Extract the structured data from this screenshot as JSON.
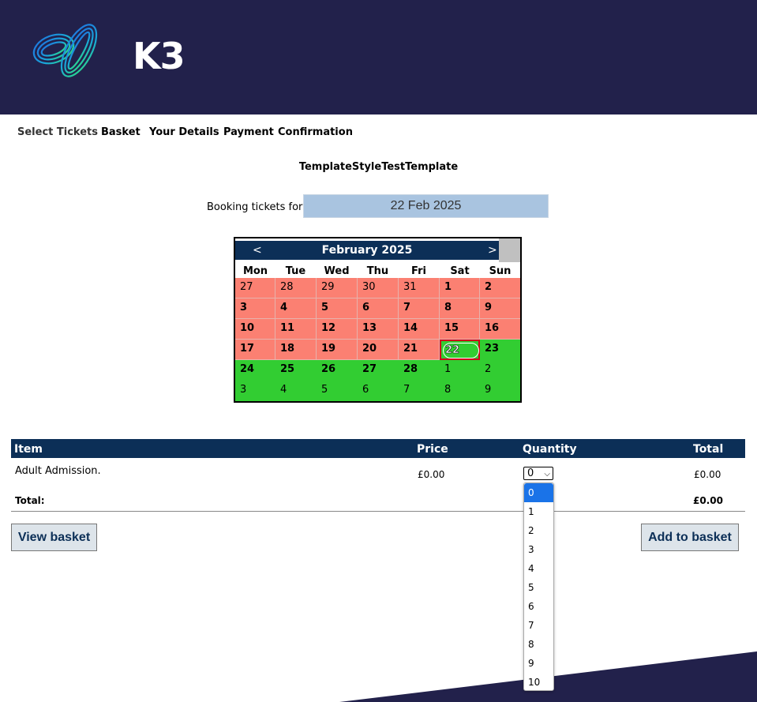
{
  "header": {
    "logo_text": "K3",
    "colors": {
      "background": "#22214b",
      "logo_blue": "#1f7ae0",
      "logo_green": "#2ecc71"
    }
  },
  "nav": {
    "items": [
      "Select Tickets",
      "Basket",
      "Your Details",
      "Payment",
      "Confirmation"
    ],
    "active": "Select Tickets"
  },
  "page_title": "TemplateStyleTestTemplate",
  "booking": {
    "label": "Booking tickets for:",
    "value": "22 Feb 2025"
  },
  "calendar": {
    "month_label": "February 2025",
    "prev_label": "<",
    "next_label": ">",
    "weekdays": [
      "Mon",
      "Tue",
      "Wed",
      "Thu",
      "Fri",
      "Sat",
      "Sun"
    ],
    "weeks": [
      [
        "27",
        "28",
        "29",
        "30",
        "31",
        "1",
        "2"
      ],
      [
        "3",
        "4",
        "5",
        "6",
        "7",
        "8",
        "9"
      ],
      [
        "10",
        "11",
        "12",
        "13",
        "14",
        "15",
        "16"
      ],
      [
        "17",
        "18",
        "19",
        "20",
        "21",
        "22",
        "23"
      ],
      [
        "24",
        "25",
        "26",
        "27",
        "28",
        "1",
        "2"
      ],
      [
        "3",
        "4",
        "5",
        "6",
        "7",
        "8",
        "9"
      ]
    ],
    "selected": "22",
    "colors": {
      "unavailable": "#fb8072",
      "available": "#32cd32",
      "header": "#0c2f57",
      "selected_border": "#d0021b"
    }
  },
  "table": {
    "headers": {
      "item": "Item",
      "price": "Price",
      "quantity": "Quantity",
      "total": "Total"
    },
    "rows": [
      {
        "item": "Adult Admission.",
        "price": "£0.00",
        "quantity": "0",
        "total": "£0.00"
      }
    ],
    "total_label": "Total:",
    "total_value": "£0.00"
  },
  "buttons": {
    "view_basket": "View basket",
    "add_to_basket": "Add to basket"
  },
  "quantity_dropdown": {
    "options": [
      "0",
      "1",
      "2",
      "3",
      "4",
      "5",
      "6",
      "7",
      "8",
      "9",
      "10"
    ],
    "highlighted": "0"
  }
}
